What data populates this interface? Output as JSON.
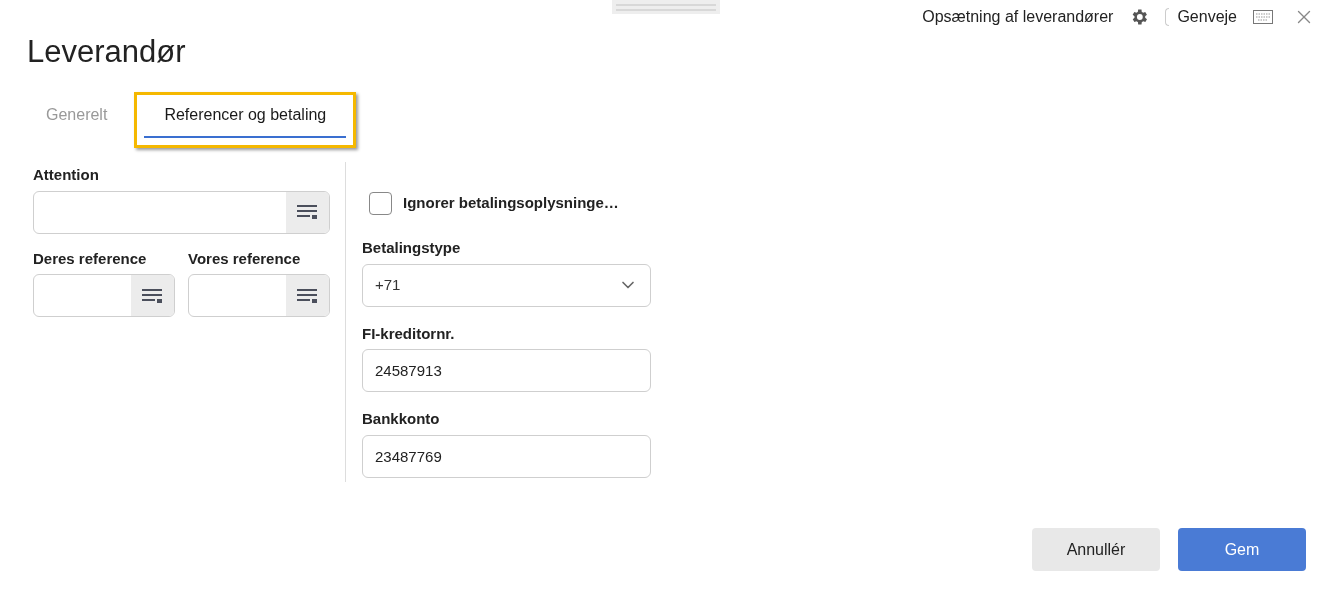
{
  "header": {
    "setup_link": "Opsætning af leverandører",
    "shortcuts": "Genveje"
  },
  "title": "Leverandør",
  "tabs": [
    {
      "label": "Generelt",
      "selected": false,
      "highlighted": false
    },
    {
      "label": "Referencer og betaling",
      "selected": true,
      "highlighted": true
    }
  ],
  "left_fields": [
    {
      "label": "Attention",
      "kind": "wide"
    },
    {
      "label": "Deres reference",
      "kind": "narrow"
    },
    {
      "label": "Vores reference",
      "kind": "narrow"
    }
  ],
  "ignore_checkbox": {
    "label": "Ignorer betalingsoplysninge…",
    "checked": false
  },
  "right_fields": [
    {
      "kind": "select",
      "label": "Betalingstype",
      "value": "+71"
    },
    {
      "kind": "text",
      "label": "FI-kreditornr.",
      "value": "24587913"
    },
    {
      "kind": "text",
      "label": "Bankkonto",
      "value": "23487769"
    }
  ],
  "buttons": [
    {
      "label": "Annullér",
      "kind": "secondary"
    },
    {
      "label": "Gem",
      "kind": "primary"
    }
  ]
}
